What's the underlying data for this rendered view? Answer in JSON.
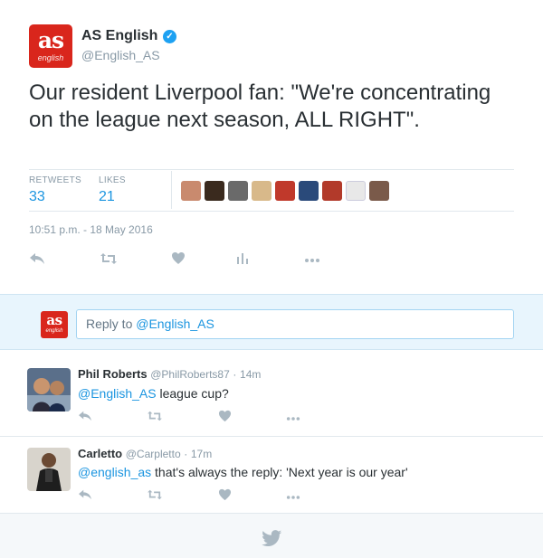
{
  "tweet": {
    "avatar": {
      "logo_text": "as",
      "logo_sub": "english",
      "color": "#d9261c"
    },
    "author_name": "AS English",
    "verified_mark": "✓",
    "author_handle": "@English_AS",
    "text": "Our resident Liverpool fan: \"We're concentrating on the league next season, ALL RIGHT\".",
    "stats": {
      "retweets_label": "RETWEETS",
      "retweets_value": "33",
      "likes_label": "LIKES",
      "likes_value": "21"
    },
    "liker_avatars": [
      "#c98a6e",
      "#3a2a1e",
      "#6a6a6a",
      "#d8b98a",
      "#c0392b",
      "#2a4a7a",
      "#b23a2a",
      "#e8e8e8",
      "#7a5a4a"
    ],
    "timestamp": "10:51 p.m. - 18 May 2016",
    "actions": {
      "reply_icon": "reply-arrow-icon",
      "retweet_icon": "retweet-icon",
      "like_icon": "heart-icon",
      "analytics_icon": "analytics-icon",
      "more_icon": "more-dots-icon"
    }
  },
  "reply_box": {
    "avatar": {
      "logo_text": "as",
      "logo_sub": "english"
    },
    "placeholder_prefix": "Reply to ",
    "placeholder_mention": "@English_AS"
  },
  "replies": [
    {
      "name": "Phil Roberts",
      "handle": "@PhilRoberts87",
      "separator": "·",
      "time": "14m",
      "mention": "@English_AS",
      "text": " league cup?"
    },
    {
      "name": "Carletto",
      "handle": "@Carpletto",
      "separator": "·",
      "time": "17m",
      "mention": "@english_as",
      "text": " that's always the reply: 'Next year is our year'"
    }
  ],
  "colors": {
    "accent": "#1b95e0",
    "muted": "#8899a6",
    "icon": "#aab8c2",
    "reply_bg": "#e8f5fd"
  }
}
